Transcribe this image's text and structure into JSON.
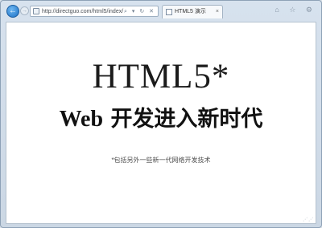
{
  "browser": {
    "address_url": "http://directguo.com/html5/index/",
    "address_icons": "⌕ ▾ ↻ ✕",
    "back_symbol": "←",
    "forward_symbol": "→",
    "tab": {
      "title": "HTML5 演示",
      "close": "×"
    },
    "toolbar_icons": "⌂ ☆ ⚙"
  },
  "page": {
    "headline": "HTML5*",
    "subheadline_latin": "Web",
    "subheadline_cjk": "开发进入新时代",
    "caption": "*包括另外一些新一代网络开发技术"
  },
  "status": {
    "grip": "⋰⋰"
  }
}
